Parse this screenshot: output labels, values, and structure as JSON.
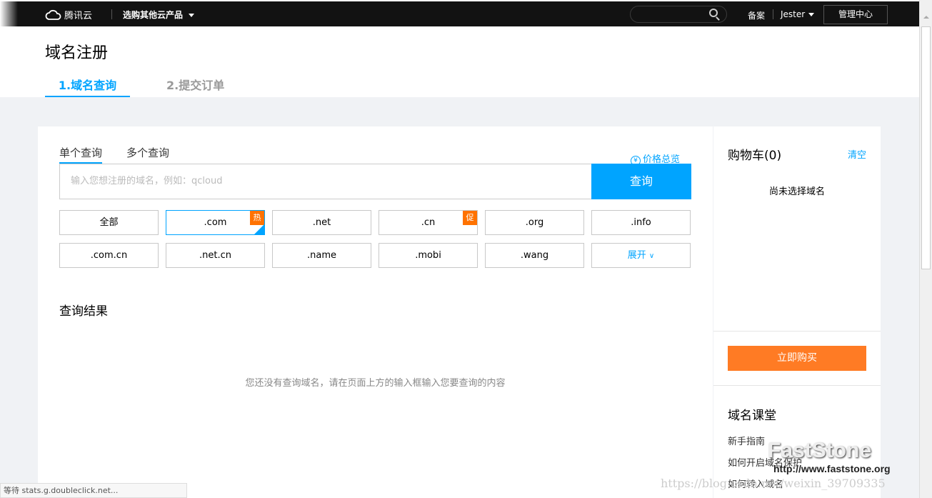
{
  "topbar": {
    "brand": "腾讯云",
    "products": "选购其他云产品",
    "beian": "备案",
    "user": "Jester",
    "console": "管理中心"
  },
  "header": {
    "title": "域名注册",
    "steps": [
      "1.域名查询",
      "2.提交订单"
    ]
  },
  "query": {
    "tabs": [
      "单个查询",
      "多个查询"
    ],
    "price_link": "价格总览",
    "placeholder": "输入您想注册的域名，例如：qcloud",
    "button": "查询",
    "tlds": [
      {
        "label": "全部"
      },
      {
        "label": ".com",
        "badge": "热",
        "selected": true
      },
      {
        "label": ".net"
      },
      {
        "label": ".cn",
        "badge": "促"
      },
      {
        "label": ".org"
      },
      {
        "label": ".info"
      },
      {
        "label": ".com.cn"
      },
      {
        "label": ".net.cn"
      },
      {
        "label": ".name"
      },
      {
        "label": ".mobi"
      },
      {
        "label": ".wang"
      }
    ],
    "expand": "展开",
    "results_title": "查询结果",
    "empty": "您还没有查询域名，请在页面上方的输入框输入您要查询的内容"
  },
  "cart": {
    "title": "购物车(0)",
    "clear": "清空",
    "empty": "尚未选择域名",
    "buy": "立即购买"
  },
  "lesson": {
    "title": "域名课堂",
    "links": [
      "新手指南",
      "如何开启域名保护",
      "如何转入域名"
    ]
  },
  "status": "等待 stats.g.doubleclick.net...",
  "watermark": {
    "brand": "FastStone",
    "url": "http://www.faststone.org",
    "blog": "https://blog.csdn.net/weixin_39709335"
  },
  "colors": {
    "accent": "#00a4ff",
    "orange": "#ff7b24"
  }
}
